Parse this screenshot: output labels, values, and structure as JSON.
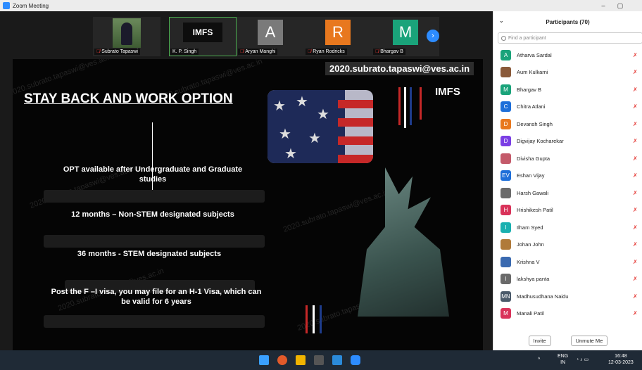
{
  "window": {
    "title": "Zoom Meeting"
  },
  "video_strip": [
    {
      "name": "Subrato Tapaswi",
      "type": "photo",
      "muted": true
    },
    {
      "name": "K. P. Singh",
      "type": "logo",
      "logo_text": "IMFS",
      "muted": false
    },
    {
      "name": "Aryan Manghi",
      "type": "letter",
      "letter": "A",
      "color": "#7a7a7a",
      "muted": true
    },
    {
      "name": "Ryan Rodricks",
      "type": "letter",
      "letter": "R",
      "color": "#e8781e",
      "muted": true
    },
    {
      "name": "Bhargav B",
      "type": "letter",
      "letter": "M",
      "color": "#1aa37a",
      "muted": true
    }
  ],
  "slide": {
    "email": "2020.subrato.tapaswi@ves.ac.in",
    "title": "STAY BACK AND WORK OPTION",
    "bullets": [
      "OPT available after Undergraduate and Graduate studies",
      "12 months – Non-STEM designated subjects",
      "36 months - STEM designated subjects",
      "Post the F –I visa, you may file for an H-1 Visa, which can be valid for 6 years"
    ],
    "logo": "IMFS",
    "watermark": "2020.subrato.tapaswi@ves.ac.in"
  },
  "participants": {
    "title": "Participants (70)",
    "search_placeholder": "Find a participant",
    "list": [
      {
        "name": "Atharva Sardal",
        "initial": "A",
        "color": "#1aa37a"
      },
      {
        "name": "Aum Kulkarni",
        "initial": "",
        "color": "#8a5a3a"
      },
      {
        "name": "Bhargav B",
        "initial": "M",
        "color": "#1aa37a"
      },
      {
        "name": "Chitra Atlani",
        "initial": "C",
        "color": "#1e6fd9"
      },
      {
        "name": "Devansh Singh",
        "initial": "D",
        "color": "#e8781e"
      },
      {
        "name": "Digvijay Kocharekar",
        "initial": "D",
        "color": "#7b3fe4"
      },
      {
        "name": "Divisha Gupta",
        "initial": "",
        "color": "#c45a6a"
      },
      {
        "name": "Eshan Vijay",
        "initial": "EV",
        "color": "#1e6fd9"
      },
      {
        "name": "Harsh Gawali",
        "initial": "",
        "color": "#6a6a6a"
      },
      {
        "name": "Hrishikesh Patil",
        "initial": "H",
        "color": "#d9335a"
      },
      {
        "name": "Ilham Syed",
        "initial": "I",
        "color": "#1ab0b0"
      },
      {
        "name": "Johan John",
        "initial": "",
        "color": "#b07a3a"
      },
      {
        "name": "Krishna V",
        "initial": "",
        "color": "#3a6ab0"
      },
      {
        "name": "lakshya panta",
        "initial": "l",
        "color": "#6a6a6a"
      },
      {
        "name": "Madhusudhana Naidu",
        "initial": "MN",
        "color": "#4a5a6a"
      },
      {
        "name": "Manali Patil",
        "initial": "M",
        "color": "#d9335a"
      }
    ],
    "invite_label": "Invite",
    "unmute_label": "Unmute Me"
  },
  "taskbar": {
    "lang": "ENG",
    "region": "IN",
    "time": "16:48",
    "date": "12-03-2023"
  }
}
